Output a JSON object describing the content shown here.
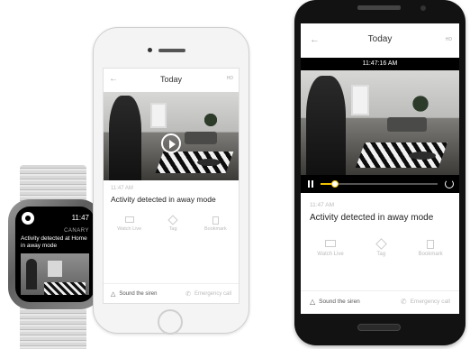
{
  "watch": {
    "time": "11:47",
    "brand": "CANARY",
    "message": "Activity detected at Home in away mode"
  },
  "iphone": {
    "nav_title": "Today",
    "nav_back": "←",
    "nav_quality": "HD",
    "event_time": "11:47 AM",
    "event_text": "Activity detected in away mode",
    "actions": [
      "Watch Live",
      "Tag",
      "Bookmark"
    ],
    "footer_left": "Sound the siren",
    "footer_right": "Emergency call"
  },
  "android": {
    "nav_title": "Today",
    "nav_back": "←",
    "nav_quality": "HD",
    "timestamp": "11:47:16 AM",
    "event_time": "11:47 AM",
    "event_text": "Activity detected in away mode",
    "actions": [
      "Watch Live",
      "Tag",
      "Bookmark"
    ],
    "footer_left": "Sound the siren",
    "footer_right": "Emergency call",
    "playback_progress": 0.12
  },
  "colors": {
    "accent": "#f2c200",
    "screen_bg": "#ffffff",
    "phone_frame_dark": "#121212"
  }
}
